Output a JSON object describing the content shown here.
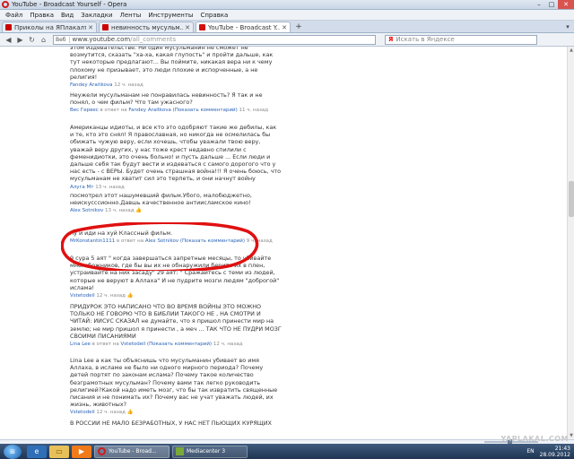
{
  "window": {
    "title": "YouTube - Broadcast Yourself - Opera",
    "controls": [
      "–",
      "□",
      "✕"
    ]
  },
  "menu": [
    "Файл",
    "Правка",
    "Вид",
    "Закладки",
    "Ленты",
    "Инструменты",
    "Справка"
  ],
  "tabs": [
    {
      "label": "Приколы на ЯПлакалъ",
      "active": false
    },
    {
      "label": "невинность мусульм...",
      "active": false
    },
    {
      "label": "YouTube - Broadcast Y...",
      "active": true
    }
  ],
  "address": {
    "badge": "Веб",
    "domain": "www.youtube.com",
    "path": "/all_comments",
    "search_placeholder": "Искать в Яндексе",
    "search_logo": "Я"
  },
  "comments": [
    {
      "text": "этом издевательстве. Ни один мусульманин не сможет не возмутится, сказать \"ха-ха, какая глупость\" и пройти дальше, как тут некоторые предлагают... Вы поймите, никакая вера ни к чему плохому не призывает, это люди плохие и испорченные, а не религия!",
      "author": "Fandey Araitkova",
      "rest": "12 ч. назад"
    },
    {
      "text": "Неужели мусульманам не понравилась невинность? Я так и не понял, о чем фильм? Что там ужасного?",
      "author": "Bec Гервес",
      "mid": " в ответ на ",
      "target": "Fandey Araitkova",
      "link": " (Показать комментарий)",
      "rest": " 11 ч. назад"
    },
    {
      "text": "Американцы идиоты, и все кто это одобряют такие же дебилы, как и те, кто это снял! Я православная, но никогда не осмелилась бы обижать чужую веру, если хочешь, чтобы уважали твою веру, уважай веру других, у нас тоже крест недавно спилили с феменидиотки, это очень больно! и пусть дальше ... Если люди и дальше себя так будут вести и издеваться с самого дорогого что у нас есть - с ВЕРЫ. Будет очень страшная война!!! Я очень боюсь, что мусульманам не хватит сил это терпеть, и они начнут войну",
      "author": "Алуга Мт",
      "rest": " 13 ч. назад"
    },
    {
      "text": "посмотрел этот нашумевший фильм.Убого, малобюджетно, неискусссионно.Дaвшь качественное антиисламское кино!",
      "author": "Alex Sotnikov",
      "rest": " 13 ч. назад",
      "thumbs": "👍"
    },
    {
      "text": "ну и иди на хуй Классный фильм.",
      "author": "MrKonstantin1111",
      "mid": " в ответ на ",
      "target": "Alex Sotnikov",
      "link": " (Показать комментарий)",
      "rest": " 9 ч. назад"
    },
    {
      "text": "9 сура 5 аят \" когда завершаться запретные месяцы, то убивайте многобожников, где бы вы их не обнаружили берите их в плен, устраивайте на них засаду\" 29 аят: \" Сражайтесь с теми из людей, которые не веруют в Аллаха\" И не пудрите мозги людям \"доброгой\" ислама!",
      "author": "Vstetodeil",
      "rest": " 12 ч. назад",
      "thumbs": "👍"
    },
    {
      "text": "ПРИДУРОК ЭТО НАПИСАНО ЧТО ВО ВРЕМЯ ВОЙНЫ ЭТО МОЖНО ТОЛЬКО НЕ ГОВОРЮ ЧТО В БИБЛИИ ТАКОГО НЕ , НА СМОТРИ И ЧИТАЙ: ИИСУС СКАЗАЛ не думайте, что я пришол принести мир на землю; не мир пришол я принести , а меч ... ТАК ЧТО НЕ ПУДРИ МОЗГ СВОИМИ ПИСАНИЯМИ",
      "author": "Lina Lee",
      "mid": " в ответ на ",
      "target": "Vstetodeil",
      "link": " (Показать комментарий)",
      "rest": " 12 ч. назад"
    },
    {
      "text": "Lina Lee а как ты объяснишь что мусульманин убивает во имя Аллаха, в исламе не было ни одного мирного периода? Почему детей портят по законам ислама? Почему такое количество безграмотных мусульман? Почему вами так легко руководить религией?Какой надо иметь мозг, что бы так извратить священные писания и не понимать их? Почему вас не учат уважать людей, их жизнь, животных?",
      "author": "Vstetodeil",
      "rest": " 12 ч. назад",
      "thumbs": "👍"
    },
    {
      "text": "В РОССИИ НЕ МАЛО БЕЗРАБОТНЫХ, У НАС НЕТ ПЬЮЩИХ КУРЯЩИХ",
      "author": "",
      "rest": ""
    }
  ],
  "taskbar": {
    "start_label": "⊞",
    "windows": [
      {
        "label": "YouTube - Broad...",
        "active": true
      },
      {
        "label": "Mediacenter 3",
        "active": false
      }
    ],
    "lang": "EN",
    "time": "21:43",
    "date": "28.09.2012"
  },
  "watermark": "YAPLAKAL.COM",
  "colors": {
    "link": "#2b63b6",
    "highlight_ellipse": "#e01010",
    "opera_red": "#d21b1b"
  }
}
